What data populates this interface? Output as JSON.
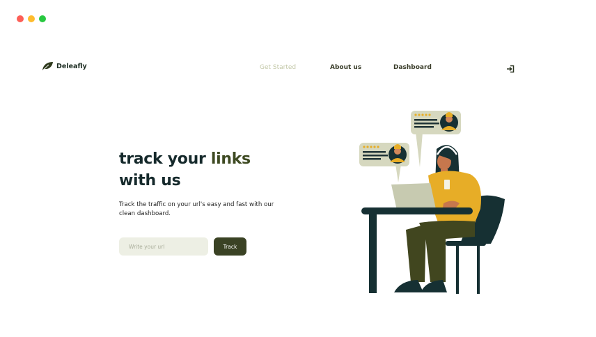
{
  "window": {
    "controls": {
      "close_color": "#fd5f57",
      "minimize_color": "#febc2e",
      "maximize_color": "#28c840"
    }
  },
  "nav": {
    "brand": "Deleafly",
    "links": [
      {
        "label": "Get Started",
        "active": true
      },
      {
        "label": "About us",
        "active": false
      },
      {
        "label": "Dashboard",
        "active": false
      }
    ],
    "login_icon": "sign-in-icon"
  },
  "hero": {
    "title_part1": "track your ",
    "title_accent": "links",
    "title_line2": "with us",
    "description": "Track the traffic on your url's easy and fast with our clean dashboard.",
    "input_placeholder": "Write your url",
    "input_value": "",
    "button_label": "Track"
  },
  "illustration": {
    "icon": "customer-support-illustration"
  },
  "colors": {
    "primary_dark": "#15292b",
    "accent_olive": "#3e4a22",
    "button_bg": "#3a4224",
    "input_bg": "#edefe4",
    "active_link": "#c3c8a8",
    "mustard": "#e7ad27"
  }
}
